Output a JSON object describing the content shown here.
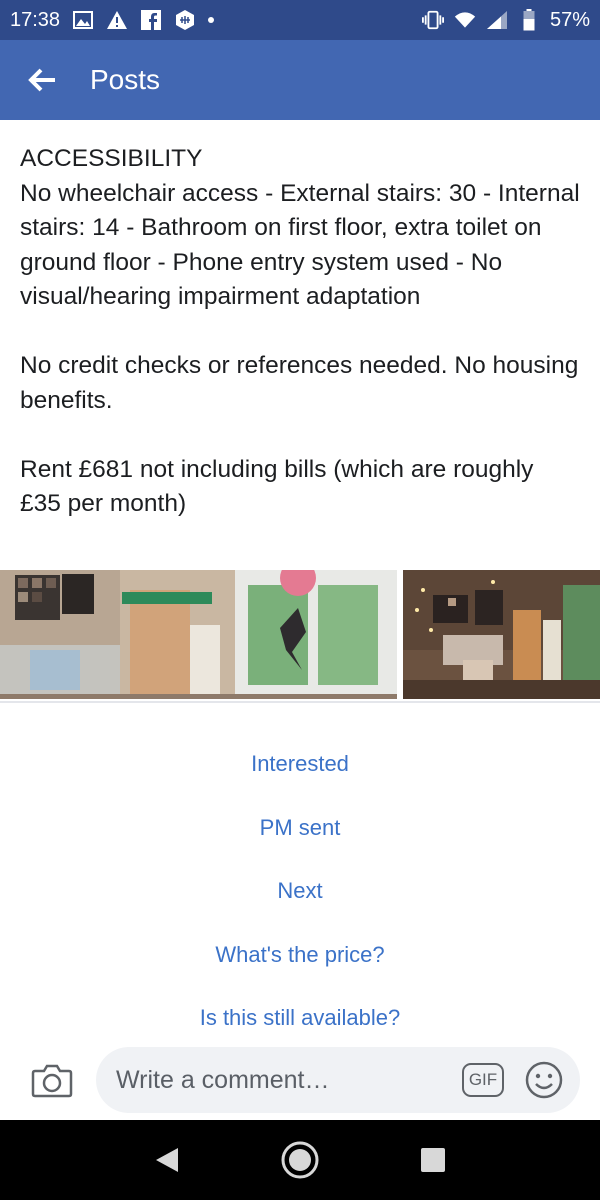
{
  "status_bar": {
    "time": "17:38",
    "battery": "57%",
    "icons_left": [
      "image-icon",
      "warning-icon",
      "facebook-icon",
      "shield-icon",
      "dot-icon"
    ],
    "icons_right": [
      "vibrate-icon",
      "wifi-icon",
      "signal-icon",
      "battery-icon"
    ]
  },
  "header": {
    "title": "Posts",
    "back_icon": "arrow-left-icon"
  },
  "post": {
    "paragraphs": [
      "ACCESSIBILITY\nNo wheelchair access - External stairs: 30 - Internal stairs: 14 - Bathroom on first floor, extra toilet on ground floor - Phone entry system used - No visual/hearing impairment adaptation",
      "No credit checks or references needed. No housing benefits.",
      "Rent £681 not including bills (which are roughly £35 per month)"
    ]
  },
  "quick_replies": [
    "Interested",
    "PM sent",
    "Next",
    "What's the price?",
    "Is this still available?"
  ],
  "composer": {
    "placeholder": "Write a comment…",
    "gif_label": "GIF"
  },
  "colors": {
    "status_bar": "#2f4a8a",
    "app_bar": "#4267b2",
    "link_blue": "#3b72c8",
    "input_bg": "#f0f2f5"
  }
}
